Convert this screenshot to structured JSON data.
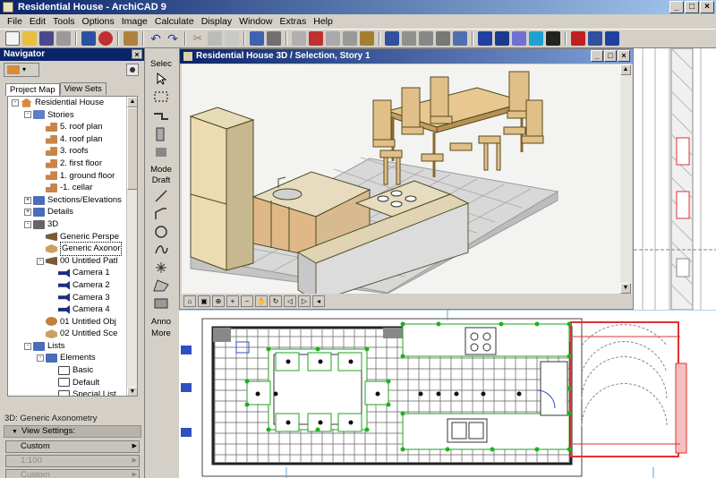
{
  "window": {
    "title": "Residential House - ArchiCAD 9",
    "minimize": "_",
    "maximize": "□",
    "close": "×"
  },
  "menu": [
    "File",
    "Edit",
    "Tools",
    "Options",
    "Image",
    "Calculate",
    "Display",
    "Window",
    "Extras",
    "Help"
  ],
  "navigator": {
    "title": "Navigator",
    "tabs": [
      "Project Map",
      "View Sets"
    ],
    "tree": [
      {
        "label": "Residential House",
        "indent": 0,
        "icon": "house",
        "exp": "-"
      },
      {
        "label": "Stories",
        "indent": 1,
        "icon": "folder",
        "exp": "-"
      },
      {
        "label": "5. roof plan",
        "indent": 2,
        "icon": "story"
      },
      {
        "label": "4. roof plan",
        "indent": 2,
        "icon": "story"
      },
      {
        "label": "3. roofs",
        "indent": 2,
        "icon": "story"
      },
      {
        "label": "2. first floor",
        "indent": 2,
        "icon": "story"
      },
      {
        "label": "1. ground floor",
        "indent": 2,
        "icon": "story"
      },
      {
        "label": "-1. cellar",
        "indent": 2,
        "icon": "story"
      },
      {
        "label": "Sections/Elevations",
        "indent": 1,
        "icon": "grid",
        "exp": "+"
      },
      {
        "label": "Details",
        "indent": 1,
        "icon": "grid",
        "exp": "+"
      },
      {
        "label": "3D",
        "indent": 1,
        "icon": "3d",
        "exp": "-"
      },
      {
        "label": "Generic Perspe",
        "indent": 2,
        "icon": "persp"
      },
      {
        "label": "Generic Axonor",
        "indent": 2,
        "icon": "axo",
        "selected": true
      },
      {
        "label": "00 Untitled Patl",
        "indent": 2,
        "icon": "persp",
        "exp": "-"
      },
      {
        "label": "Camera 1",
        "indent": 3,
        "icon": "cam"
      },
      {
        "label": "Camera 2",
        "indent": 3,
        "icon": "cam"
      },
      {
        "label": "Camera 3",
        "indent": 3,
        "icon": "cam"
      },
      {
        "label": "Camera 4",
        "indent": 3,
        "icon": "cam"
      },
      {
        "label": "01 Untitled Obj",
        "indent": 2,
        "icon": "obj"
      },
      {
        "label": "02 Untitled Sce",
        "indent": 2,
        "icon": "axo"
      },
      {
        "label": "Lists",
        "indent": 1,
        "icon": "grid",
        "exp": "-"
      },
      {
        "label": "Elements",
        "indent": 2,
        "icon": "grid",
        "exp": "-"
      },
      {
        "label": "Basic",
        "indent": 3,
        "icon": "doc"
      },
      {
        "label": "Default",
        "indent": 3,
        "icon": "doc"
      },
      {
        "label": "Special List",
        "indent": 3,
        "icon": "doc"
      }
    ],
    "info_label": "3D: Generic Axonometry",
    "view_settings": "View Settings:",
    "fields": [
      "Custom",
      "1:100",
      "Custom"
    ]
  },
  "toolbox": {
    "select": "Selec",
    "mode": "Mode",
    "draft": "Draft",
    "anno": "Anno",
    "more": "More"
  },
  "view3d": {
    "title": "Residential House 3D / Selection, Story 1"
  },
  "colors": {
    "titlebar": "#0a246a",
    "chrome": "#d4d0c8",
    "wall_red": "#e03030",
    "dot_green": "#20b020"
  }
}
